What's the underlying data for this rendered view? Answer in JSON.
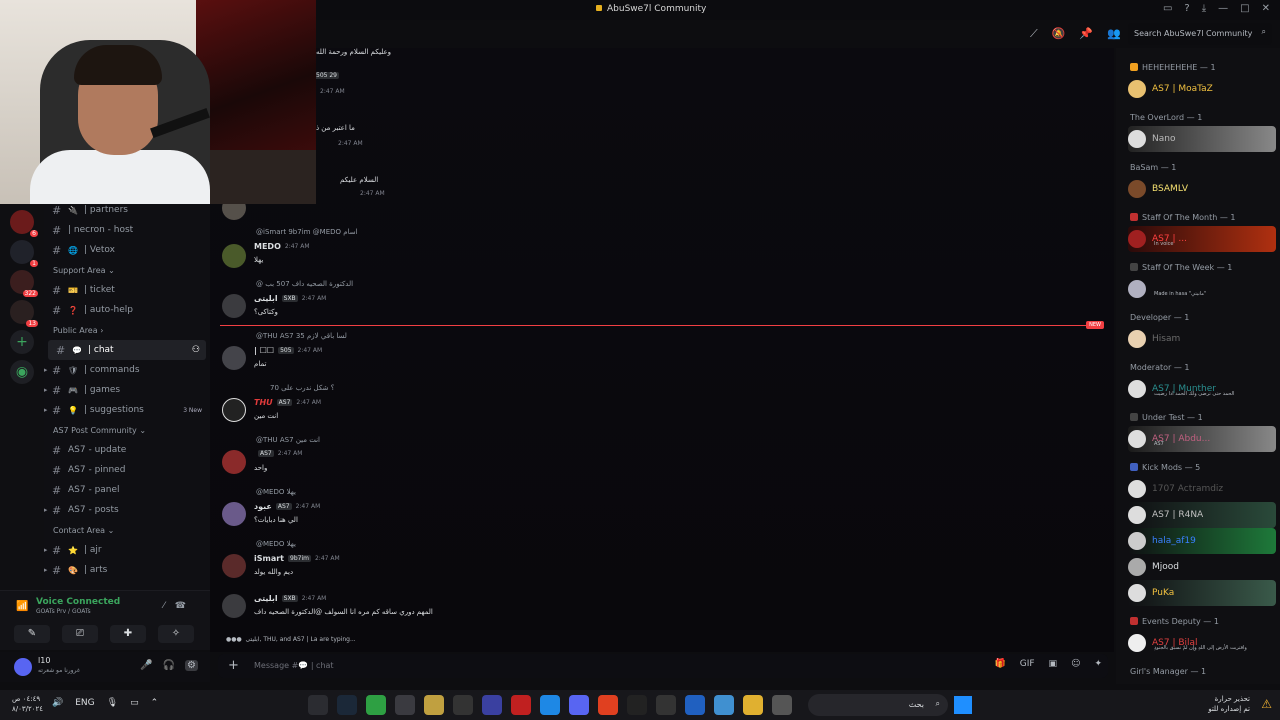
{
  "window": {
    "title": "AbuSwe7l Community",
    "controls": [
      "inbox",
      "help",
      "download",
      "minimize",
      "maximize",
      "close"
    ]
  },
  "search": {
    "placeholder": "Search AbuSwe7l Community"
  },
  "header_icons": [
    "threads-icon",
    "mute-icon",
    "pin-icon",
    "members-icon"
  ],
  "sidebar": {
    "items": [
      {
        "type": "channel",
        "icon": "#",
        "emoji": "🔌",
        "label": "| partners"
      },
      {
        "type": "channel",
        "icon": "#",
        "emoji": "",
        "label": "| necron - host"
      },
      {
        "type": "channel",
        "icon": "#",
        "emoji": "🌐",
        "label": "| Vetox"
      },
      {
        "type": "category",
        "label": "Support Area"
      },
      {
        "type": "channel",
        "icon": "#",
        "emoji": "🎫",
        "label": "| ticket"
      },
      {
        "type": "channel",
        "icon": "#",
        "emoji": "❓",
        "label": "| auto-help"
      },
      {
        "type": "category",
        "label": "Public Area"
      },
      {
        "type": "channel",
        "icon": "#",
        "emoji": "💬",
        "label": "| chat",
        "active": true
      },
      {
        "type": "channel",
        "icon": "#",
        "emoji": "🛡",
        "label": "| commands"
      },
      {
        "type": "channel",
        "icon": "#",
        "emoji": "🎮",
        "label": "| games"
      },
      {
        "type": "channel",
        "icon": "#",
        "emoji": "💡",
        "label": "| suggestions",
        "new": "3 New"
      },
      {
        "type": "category",
        "label": "AS7 Post Community"
      },
      {
        "type": "channel",
        "icon": "#",
        "emoji": "",
        "label": "AS7 - update"
      },
      {
        "type": "channel",
        "icon": "#",
        "emoji": "",
        "label": "AS7 - pinned"
      },
      {
        "type": "channel",
        "icon": "#",
        "emoji": "",
        "label": "AS7 - panel"
      },
      {
        "type": "channel",
        "icon": "#",
        "emoji": "",
        "label": "AS7 - posts"
      },
      {
        "type": "category",
        "label": "Contact Area"
      },
      {
        "type": "channel",
        "icon": "#",
        "emoji": "⭐",
        "label": "| ajr"
      },
      {
        "type": "channel",
        "icon": "#",
        "emoji": "🎨",
        "label": "| arts"
      }
    ],
    "server_badges": [
      "6",
      "1",
      "322",
      "13"
    ]
  },
  "voice": {
    "status": "Voice Connected",
    "channel": "GOATs Prv / GOATs"
  },
  "user": {
    "name": "l10",
    "status": "غرورنا مو شعرته"
  },
  "messages": [
    {
      "name": "",
      "time": "2:47 AM",
      "reply": "",
      "body": "وعليكم السلام ورحمة الله",
      "meta": "505   29"
    },
    {
      "name": "",
      "time": "2:47 AM",
      "reply": "",
      "body": "ما اعتبر من ذا",
      "meta": ""
    },
    {
      "name": "",
      "time": "2:47 AM",
      "reply": "",
      "body": "السلام عليكم",
      "meta": ""
    },
    {
      "name": "MEDO",
      "time": "2:47 AM",
      "reply": "@iSmart 9b7im @MEDO اسام",
      "body": "يهلا",
      "meta": ""
    },
    {
      "name": "ابلیتی",
      "time": "2:47 AM",
      "reply": "@ الدكتورة الصحيه داف 507 بب",
      "body": "وكتاكى؟",
      "meta": "SXB"
    },
    {
      "name": "| ☐☐",
      "time": "2:47 AM",
      "reply": "@THU AS7 لسا باقي لازم 35",
      "body": "تمام",
      "meta": "505"
    },
    {
      "name": "THU",
      "time": "2:47 AM",
      "reply": "70 ؟ شكل ندرب على",
      "body": "انت مين",
      "meta": "AS7"
    },
    {
      "name": "",
      "time": "2:47 AM",
      "reply": "@THU AS7 انت مين",
      "body": "واحد",
      "meta": "AS7"
    },
    {
      "name": "عبود",
      "time": "2:47 AM",
      "reply": "@MEDO يهلا",
      "body": "الي هنا دبايات؟",
      "meta": "AS7"
    },
    {
      "name": "iSmart",
      "time": "2:47 AM",
      "reply": "@MEDO يهلا",
      "body": "ديم والله يولد",
      "meta": "9b7im"
    },
    {
      "name": "ابلیتی",
      "time": "2:47 AM",
      "reply": "",
      "body": "المهم دوري ساقه كم مره انا السولف @الدكتورة الصحيه داف",
      "meta": "SXB"
    }
  ],
  "typing": "ابلیتی, THU, and AS7 | La are typing...",
  "new_marker": "NEW",
  "composer": {
    "placeholder": "Message #💬 | chat"
  },
  "members": {
    "groups": [
      {
        "role": "HEHEHEHEHE — 1",
        "users": [
          {
            "name": "AS7 | MoaTaZ",
            "status": "",
            "color": "#f0c040"
          }
        ]
      },
      {
        "role": "The OverLord — 1",
        "users": [
          {
            "name": "Nano",
            "status": "",
            "color": "#888888"
          }
        ]
      },
      {
        "role": "BaSam — 1",
        "users": [
          {
            "name": "BSAMLV",
            "status": "",
            "color": "#f5e070"
          }
        ]
      },
      {
        "role": "Staff Of The Month — 1",
        "users": [
          {
            "name": "AS7 | ... ",
            "status": "In voice",
            "color": "#ff4040"
          }
        ]
      },
      {
        "role": "Staff Of The Week — 1",
        "users": [
          {
            "name": "",
            "status": "Made in hasa \"مانيتي\"",
            "color": "#c060ff"
          }
        ]
      },
      {
        "role": "Developer — 1",
        "users": [
          {
            "name": "Hisam",
            "status": "",
            "color": "#6a6a6a"
          }
        ]
      },
      {
        "role": "Moderator — 1",
        "users": [
          {
            "name": "AS7 | Munther",
            "status": "الحمد حتى ترضى ولك الحمد اذا رضيت",
            "color": "#2a8f8f"
          }
        ]
      },
      {
        "role": "Under Test — 1",
        "users": [
          {
            "name": "AS7 | Abdu...",
            "status": "AS7",
            "color": "#c06080"
          }
        ]
      },
      {
        "role": "Kick Mods — 5",
        "users": [
          {
            "name": "1707 Actramdiz",
            "status": "",
            "color": "#555555"
          },
          {
            "name": "AS7 | R4NA",
            "status": "",
            "color": "#c0c0c0"
          },
          {
            "name": "hala_af19",
            "status": "",
            "color": "#3a80ff"
          },
          {
            "name": "Mjood",
            "status": "",
            "color": "#dbdee1"
          },
          {
            "name": "PuKa",
            "status": "",
            "color": "#f0c040"
          }
        ]
      },
      {
        "role": "Events Deputy — 1",
        "users": [
          {
            "name": "AS7 | Bilal",
            "status": "واقتربت الأرض إلى اللهِ وإن لمْ نسبق بالجنودِ",
            "color": "#e04040"
          }
        ]
      },
      {
        "role": "Girl's Manager — 1",
        "users": []
      }
    ]
  },
  "taskbar": {
    "time": "٠٤:٤٩ ص",
    "date": "٨/٠٣/٢٠٢٤",
    "lang": "ENG",
    "search": "بحث",
    "notice_title": "تحذير حرارة",
    "notice_sub": "تم إصداره للتو"
  }
}
